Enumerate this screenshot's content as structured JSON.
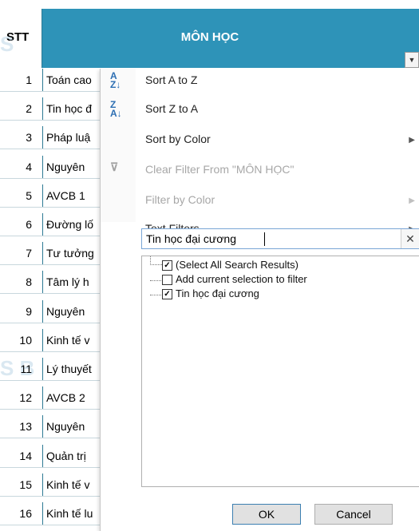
{
  "header": {
    "stt": "STT",
    "mon_hoc": "MÔN HỌC",
    "dropdown_glyph": "▼"
  },
  "rows": [
    {
      "stt": "1",
      "name": "Toán cao"
    },
    {
      "stt": "2",
      "name": "Tin học đ"
    },
    {
      "stt": "3",
      "name": "Pháp luậ"
    },
    {
      "stt": "4",
      "name": "Nguyên"
    },
    {
      "stt": "5",
      "name": "AVCB 1"
    },
    {
      "stt": "6",
      "name": "Đường lố"
    },
    {
      "stt": "7",
      "name": "Tư tưởng"
    },
    {
      "stt": "8",
      "name": "Tâm lý h"
    },
    {
      "stt": "9",
      "name": "Nguyên"
    },
    {
      "stt": "10",
      "name": "Kinh tế v"
    },
    {
      "stt": "11",
      "name": "Lý thuyết"
    },
    {
      "stt": "12",
      "name": "AVCB 2"
    },
    {
      "stt": "13",
      "name": "Nguyên"
    },
    {
      "stt": "14",
      "name": "Quản trị"
    },
    {
      "stt": "15",
      "name": "Kinh tế v"
    },
    {
      "stt": "16",
      "name": "Kinh tế lu"
    }
  ],
  "menu": {
    "sort_az": "Sort A to Z",
    "sort_za": "Sort Z to A",
    "sort_color": "Sort by Color",
    "clear_filter": "Clear Filter From \"MÔN HỌC\"",
    "filter_color": "Filter by Color",
    "text_filters": "Text Filters"
  },
  "search": {
    "value": "Tin học đại cương",
    "clear_glyph": "✕"
  },
  "list": {
    "select_all": "(Select All Search Results)",
    "add_current": "Add current selection to filter",
    "item": "Tin học đại cương"
  },
  "buttons": {
    "ok": "OK",
    "cancel": "Cancel"
  }
}
